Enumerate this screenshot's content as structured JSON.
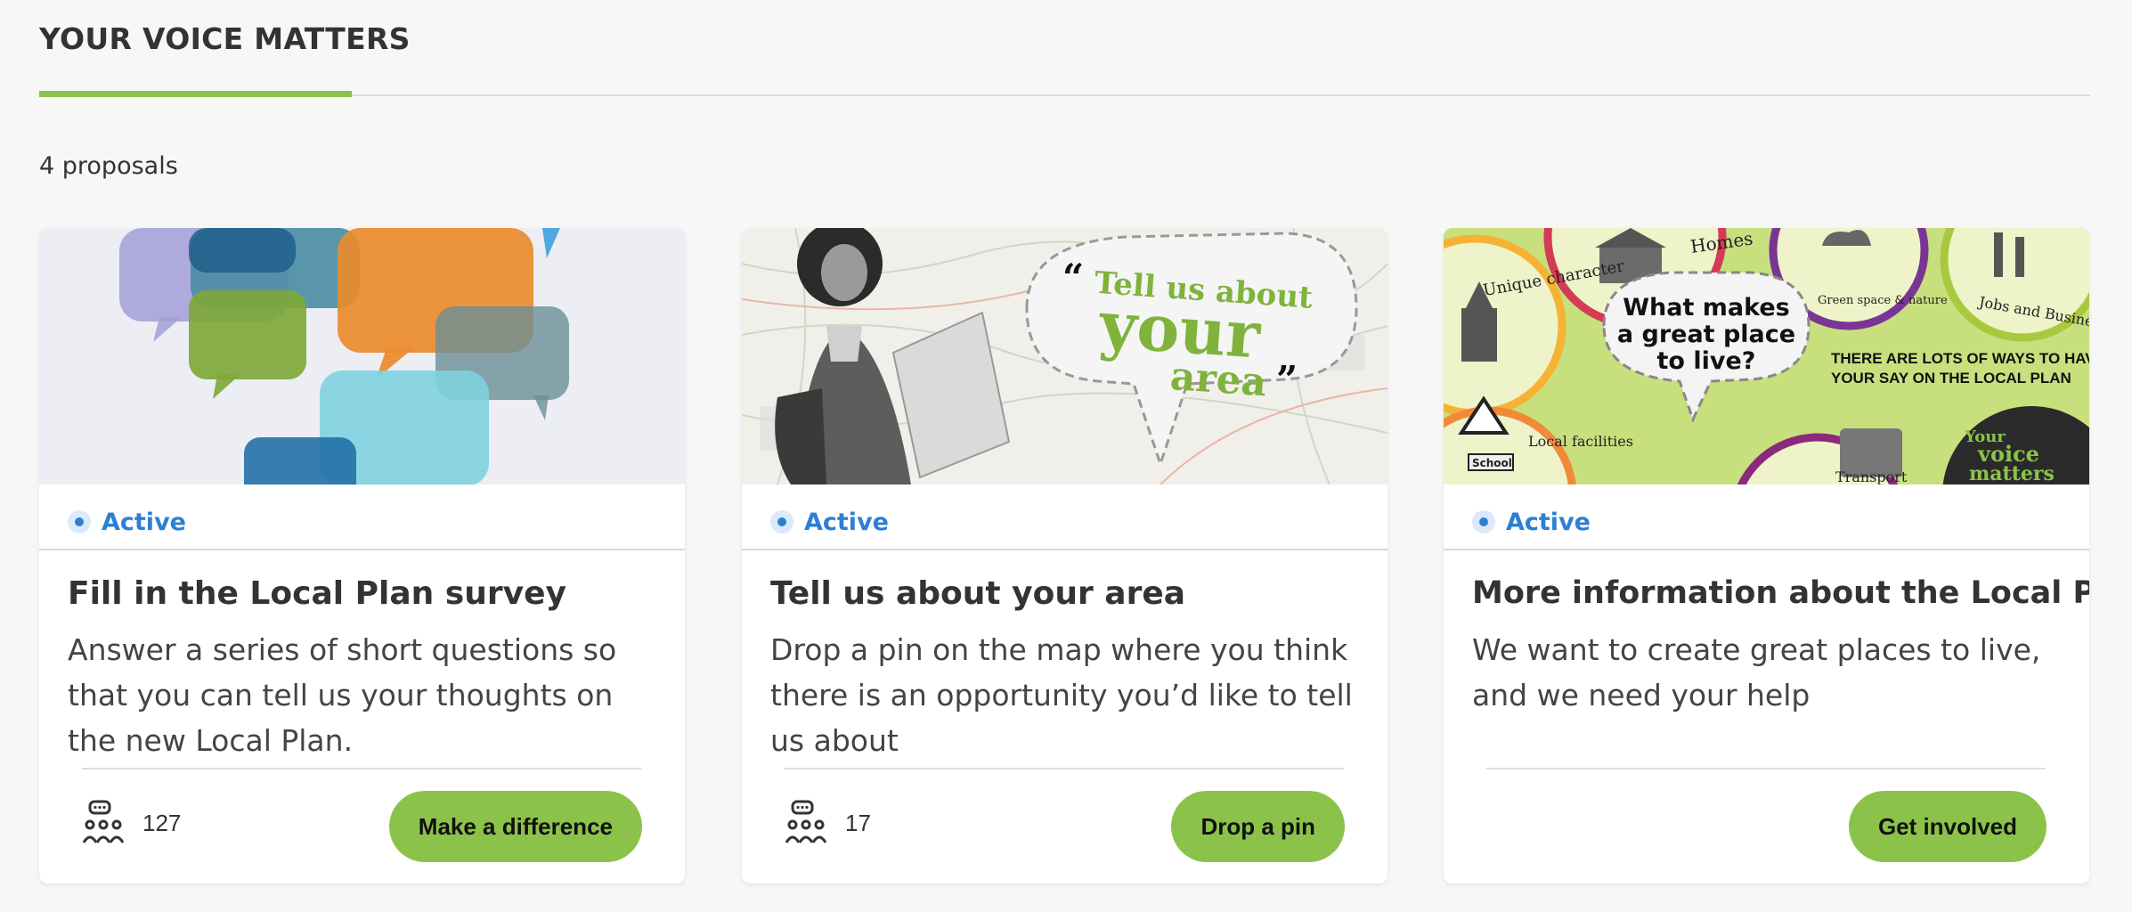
{
  "header": {
    "title": "YOUR VOICE MATTERS"
  },
  "summary": {
    "count_text": "4 proposals"
  },
  "colors": {
    "accent": "#8bc34a",
    "status": "#2d7fd3",
    "text": "#333333"
  },
  "cards": [
    {
      "status": "Active",
      "title": "Fill in the Local Plan survey",
      "description": "Answer a series of short questions so that you can tell us your thoughts on the new Local Plan.",
      "participants": "127",
      "cta": "Make a difference",
      "image": {
        "kind": "speech-bubbles-collage"
      }
    },
    {
      "status": "Active",
      "title": "Tell us about your area",
      "description": "Drop a pin on the map where you think there is an opportunity you’d like to tell us about",
      "participants": "17",
      "cta": "Drop a pin",
      "image": {
        "kind": "map-with-person",
        "lines": [
          "Tell us about",
          "your",
          "area"
        ]
      }
    },
    {
      "status": "Active",
      "title": "More information about the Local Plan",
      "description": "We want to create great places to live, and we need your help",
      "cta": "Get involved",
      "image": {
        "kind": "local-plan-themes",
        "headline": [
          "What makes",
          "a great place",
          "to live?"
        ],
        "subtext": [
          "THERE ARE LOTS OF WAYS TO HAVE",
          "YOUR SAY ON THE LOCAL PLAN"
        ],
        "badge": [
          "Your",
          "voice",
          "matters"
        ],
        "themes": [
          "Unique character",
          "Homes",
          "Green space & nature",
          "Jobs and Business",
          "Local facilities",
          "Transport",
          "School"
        ]
      }
    }
  ]
}
